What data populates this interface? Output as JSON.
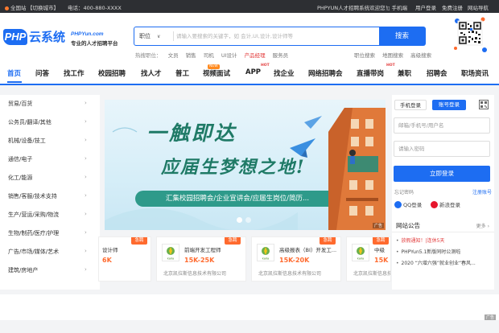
{
  "topbar": {
    "site": "全国站",
    "switch_city": "【切换城市】",
    "phone": "电话：400-880-XXXX",
    "welcome": "PHPYUN人才招聘系统欢迎您！",
    "mobile": "手机端",
    "user_login": "用户登录",
    "register": "免费注册",
    "site_nav": "网站导航"
  },
  "logo": {
    "brand": "PHP",
    "yun": "云系统",
    "url": "PHPYun.com",
    "tagline": "专业的人才招聘平台"
  },
  "search": {
    "type": "职位",
    "placeholder": "请输入要搜索的关键字，如 会计,UI,设计,设计师等",
    "button": "搜索"
  },
  "hot_searches": {
    "label": "热搜职位：",
    "items": [
      "文员",
      "销售",
      "司机",
      "UI设计",
      "产品经理",
      "服务员"
    ]
  },
  "quick_links": [
    "职位搜索",
    "地图搜索",
    "高级搜索"
  ],
  "nav": {
    "items": [
      {
        "label": "首页",
        "active": true
      },
      {
        "label": "问答"
      },
      {
        "label": "找工作"
      },
      {
        "label": "校园招聘"
      },
      {
        "label": "找人才"
      },
      {
        "label": "普工"
      },
      {
        "label": "视频面试",
        "badge": "NEW"
      },
      {
        "label": "APP",
        "badge": "HOT"
      },
      {
        "label": "找企业"
      },
      {
        "label": "网络招聘会"
      },
      {
        "label": "直播带岗",
        "badge": "HOT"
      },
      {
        "label": "兼职"
      },
      {
        "label": "招聘会"
      },
      {
        "label": "职场资讯"
      }
    ]
  },
  "categories": [
    "贸易/百货",
    "公务员/翻译/其他",
    "机械/设备/技工",
    "通信/电子",
    "化工/能源",
    "销售/客服/技术支持",
    "生产/营运/采购/物流",
    "生物/制药/医疗/护理",
    "广告/市场/媒体/艺术",
    "建筑/房地产"
  ],
  "banner": {
    "title1": "一触即达",
    "title2": "应届生梦想之地!",
    "strip": "汇集校园招聘会/企业宣讲会/应届生岗位/简历...",
    "ad": "广告"
  },
  "jobs": [
    {
      "title": "设计师",
      "salary": "6K",
      "company": "",
      "tag": "急聘"
    },
    {
      "title": "前端开发工程师",
      "salary": "15K-25K",
      "company": "北京凯拉斯信息技术有限公司",
      "tag": "急聘"
    },
    {
      "title": "高级报表（BI）开发工...",
      "salary": "15K-20K",
      "company": "北京凯拉斯信息技术有限公司",
      "tag": "急聘"
    },
    {
      "title": "中级",
      "salary": "15K",
      "company": "北京凯拉斯信息技",
      "tag": "急聘"
    }
  ],
  "login": {
    "tab_phone": "手机登录",
    "tab_account": "账号登录",
    "username_placeholder": "邮箱/手机号/用户名",
    "password_placeholder": "请输入密码",
    "submit": "立即登录",
    "forgot": "忘记密码",
    "register": "注册账号",
    "qq": "QQ登录",
    "weibo": "新浪登录"
  },
  "notice": {
    "title": "网站公告",
    "more": "更多",
    "items": [
      {
        "text": "放假通知！|连休5天",
        "highlight": true
      },
      {
        "text": "PHPYun5.1新版同时公测啦",
        "highlight": false
      },
      {
        "text": "2020 “六增六强”就业创业“春风...",
        "highlight": false
      }
    ]
  },
  "bottom_ad": "广告",
  "colors": {
    "brand": "#1d6df2",
    "accent": "#ff6a2e",
    "hot": "#e23b3b"
  }
}
